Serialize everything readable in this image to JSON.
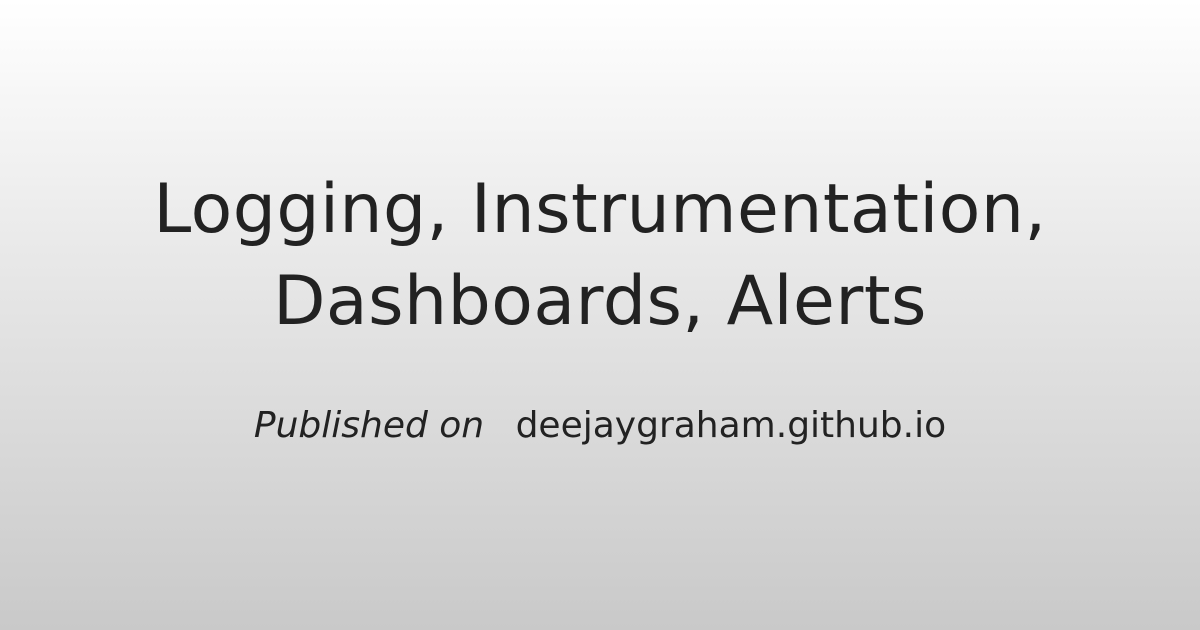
{
  "card": {
    "title_lines": [
      "Logging, Instrumentation,",
      "Dashboards, Alerts"
    ],
    "byline": {
      "prefix": "Published on",
      "site": "deejaygraham.github.io"
    }
  },
  "colors": {
    "text": "#222222",
    "background_top": "#ffffff",
    "background_bottom": "#c9c9c9"
  }
}
